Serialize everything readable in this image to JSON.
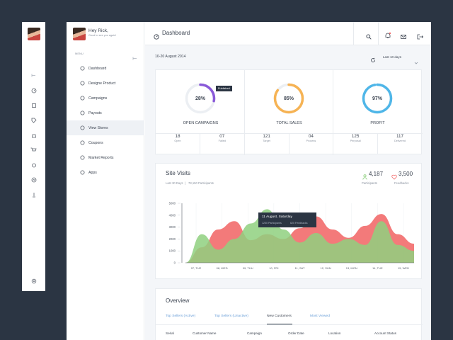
{
  "user": {
    "greeting": "Hey Rick,",
    "subtitle": "Good to see you again!"
  },
  "nav": {
    "menu_label": "MENU",
    "items": [
      {
        "label": "Dashboard",
        "icon": "dashboard-icon"
      },
      {
        "label": "Designe Product",
        "icon": "product-icon"
      },
      {
        "label": "Campaigns",
        "icon": "tag-icon"
      },
      {
        "label": "Payouts",
        "icon": "payouts-icon"
      },
      {
        "label": "View Stores",
        "icon": "cart-icon"
      },
      {
        "label": "Coupons",
        "icon": "coupon-icon"
      },
      {
        "label": "Market Reports",
        "icon": "report-icon"
      },
      {
        "label": "Apps",
        "icon": "apps-icon"
      }
    ],
    "active_index": 4
  },
  "header": {
    "title": "Dashboard"
  },
  "date_range": "10-20 August 2014",
  "period_select": "Last 10 days",
  "kpis": [
    {
      "value": "28%",
      "label": "OPEN CAMPAIGNS",
      "fraction": 0.28,
      "color": "#8a5ad8"
    },
    {
      "value": "85%",
      "label": "TOTAL SALES",
      "fraction": 0.85,
      "color": "#f6b354"
    },
    {
      "value": "97%",
      "label": "PROFIT",
      "fraction": 0.97,
      "color": "#4fb6e8"
    }
  ],
  "kpi_tooltip": "Published",
  "stats": [
    {
      "value": "18",
      "label": "Open"
    },
    {
      "value": "07",
      "label": "Failed"
    },
    {
      "value": "121",
      "label": "Target"
    },
    {
      "value": "04",
      "label": "Process"
    },
    {
      "value": "125",
      "label": "Perposal"
    },
    {
      "value": "117",
      "label": "Delivered"
    }
  ],
  "site_visits": {
    "title": "Site Visits",
    "subtitle_period": "Last 30 Days",
    "subtitle_participants": "78,150 Participants",
    "participants": {
      "value": "4,187",
      "label": "Participants"
    },
    "feedbacks": {
      "value": "3,500",
      "label": "Feedbacks"
    },
    "tooltip": {
      "title": "11 August, Saturday",
      "line1": "1250 Participants",
      "line2": "620 Feedbacks"
    }
  },
  "chart_data": {
    "type": "area",
    "categories": [
      "07, TUE",
      "08, WED",
      "09, THU",
      "10, FRI",
      "11, SAT",
      "12, SUN",
      "13, MON",
      "14, TUE",
      "15, WED"
    ],
    "ylim": [
      0,
      5000
    ],
    "yticks": [
      "5000",
      "4000",
      "3000",
      "2000",
      "1000",
      "0"
    ],
    "series": [
      {
        "color": "#f26b6b",
        "values": [
          0,
          1300,
          2800,
          3500,
          1900,
          2400,
          2000,
          2900,
          3900,
          2800,
          2100,
          3100,
          4100,
          2400,
          1600
        ]
      },
      {
        "color": "#8fd07f",
        "values": [
          0,
          2400,
          1100,
          2000,
          3300,
          4500,
          2800,
          1700,
          2500,
          1600,
          2000,
          1500,
          3500,
          1500,
          1000
        ]
      }
    ]
  },
  "overview": {
    "title": "Overview",
    "tabs": [
      "Top Sellers (Active)",
      "Top Sellers (Unactive)",
      "New Customers",
      "Most Viewed"
    ],
    "active_tab": 2,
    "columns": [
      "Serial",
      "Customer Name",
      "Campaign",
      "Order Date",
      "Location",
      "Account Status"
    ]
  }
}
